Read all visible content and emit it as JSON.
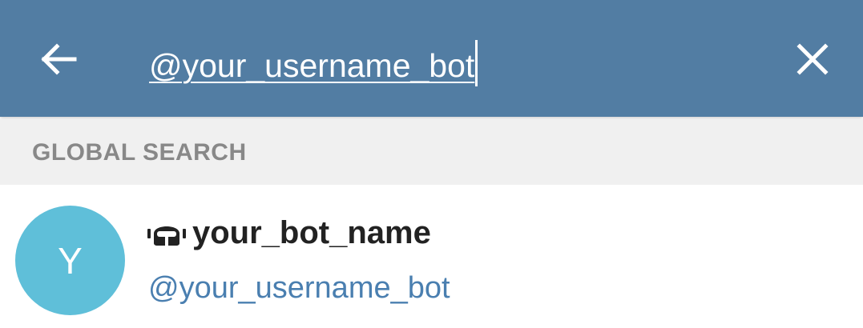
{
  "header": {
    "search_value": "@your_username_bot",
    "back_icon": "arrow-left-icon",
    "close_icon": "close-icon"
  },
  "section": {
    "title": "GLOBAL SEARCH"
  },
  "results": [
    {
      "avatar_letter": "Y",
      "name": "your_bot_name",
      "username": "@your_username_bot",
      "type_icon": "bot-icon"
    }
  ],
  "colors": {
    "topbar": "#527da3",
    "section_bg": "#f0f0f0",
    "section_text": "#888888",
    "avatar": "#5fbfd9",
    "username": "#4a7fb0",
    "name": "#222222"
  }
}
